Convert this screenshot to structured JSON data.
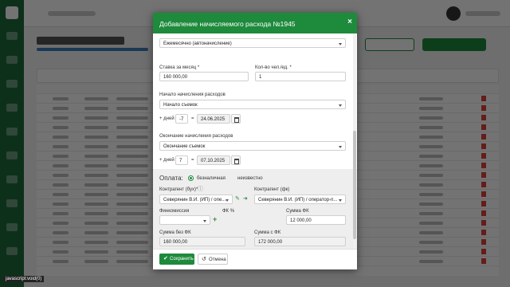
{
  "modal": {
    "title": "Добавление начисляемого расхода №1945",
    "close_glyph": "×",
    "fields": {
      "frequency_value": "Ежемесячно (автоначисление)",
      "rate_label": "Ставка за месяц",
      "rate_value": "160 000,00",
      "qty_label": "Кол-во чел./ед.",
      "qty_value": "1",
      "start_label": "Начало начисления расходов",
      "start_select": "Начало съемок",
      "start_days_prefix": "+ дней",
      "start_days": "-7",
      "start_eq": "=",
      "start_date": "24.06.2025",
      "end_label": "Окончание начисления расходов",
      "end_select": "Окончание съемок",
      "end_days_prefix": "+ дней",
      "end_days": "7",
      "end_eq": "=",
      "end_date": "07.10.2025"
    },
    "payment": {
      "label": "Оплата:",
      "option_cashless": "безналичная",
      "option_unknown": "неизвестно",
      "contractor_ours_label": "Контрагент (бух)*",
      "contractor_ours_value": "Северянин В.И. (ИП) / опе...",
      "contractor_fk_label": "Контрагент (фк)",
      "contractor_fk_value": "Северянин В.И. (ИП) / оператор-п...",
      "fincommission_label": "Финкомиссия",
      "fk_percent_label": "ФК %",
      "sum_fk_label": "Сумма ФК",
      "sum_fk_value": "12 000,00",
      "sum_without_fk_label": "Сумма без ФК",
      "sum_without_fk_value": "160 000,00",
      "sum_with_fk_label": "Сумма с ФК",
      "sum_with_fk_value": "172 000,00"
    },
    "footer": {
      "save_label": "Сохранить",
      "cancel_label": "Отмена"
    }
  },
  "status_bar": {
    "url": "javascript:void(0)"
  },
  "colors": {
    "brand_green": "#1e8a3c",
    "sidebar_green": "#1e6b3a",
    "danger": "#e0403a"
  },
  "icons": {
    "save": "check-icon",
    "cancel": "undo-icon",
    "info": "info-icon",
    "edit": "pencil-icon",
    "go": "arrow-right-icon",
    "add": "plus-icon",
    "calendar": "calendar-icon"
  }
}
